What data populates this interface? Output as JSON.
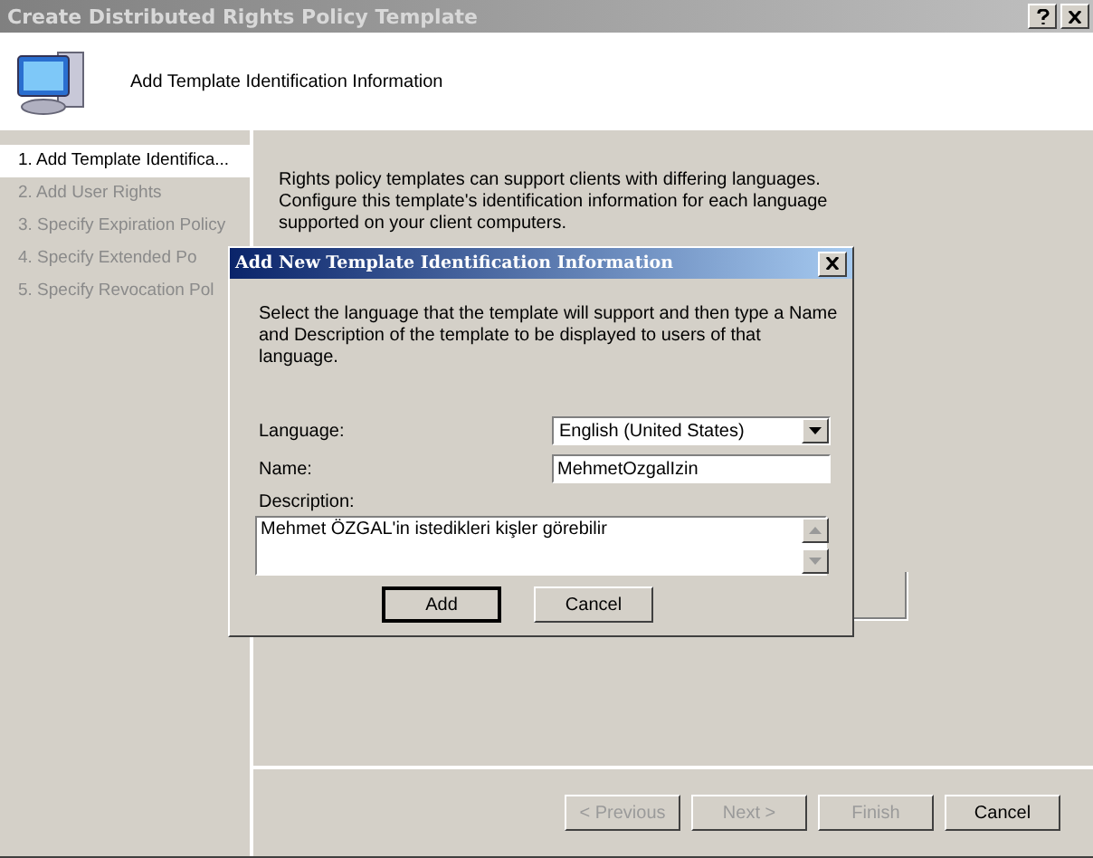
{
  "window": {
    "title": "Create Distributed Rights Policy Template"
  },
  "header": {
    "title": "Add Template Identification Information"
  },
  "steps": [
    {
      "label": "1. Add Template Identifica...",
      "selected": true
    },
    {
      "label": "2. Add User Rights",
      "selected": false
    },
    {
      "label": "3. Specify Expiration Policy",
      "selected": false
    },
    {
      "label": "4. Specify Extended Po",
      "selected": false
    },
    {
      "label": "5. Specify Revocation Pol",
      "selected": false
    }
  ],
  "intro": "Rights policy templates can support clients with differing languages. Configure this template's identification information for each language supported on your client computers.",
  "dialog": {
    "title": "Add New Template Identification Information",
    "instructions": "Select the language that the template will support and then type a Name and Description of the template to be displayed to users of that language.",
    "language_label": "Language:",
    "language_value": "English (United States)",
    "name_label": "Name:",
    "name_value": "MehmetOzgalIzin",
    "description_label": "Description:",
    "description_value": "Mehmet ÖZGAL'in istedikleri kişler görebilir",
    "buttons": [
      {
        "label": "Add",
        "default": true
      },
      {
        "label": "Cancel",
        "default": false
      }
    ]
  },
  "wizard_buttons": [
    {
      "label": "< Previous",
      "disabled": true
    },
    {
      "label": "Next >",
      "disabled": true
    },
    {
      "label": "Finish",
      "disabled": true
    },
    {
      "label": "Cancel",
      "disabled": false
    }
  ]
}
